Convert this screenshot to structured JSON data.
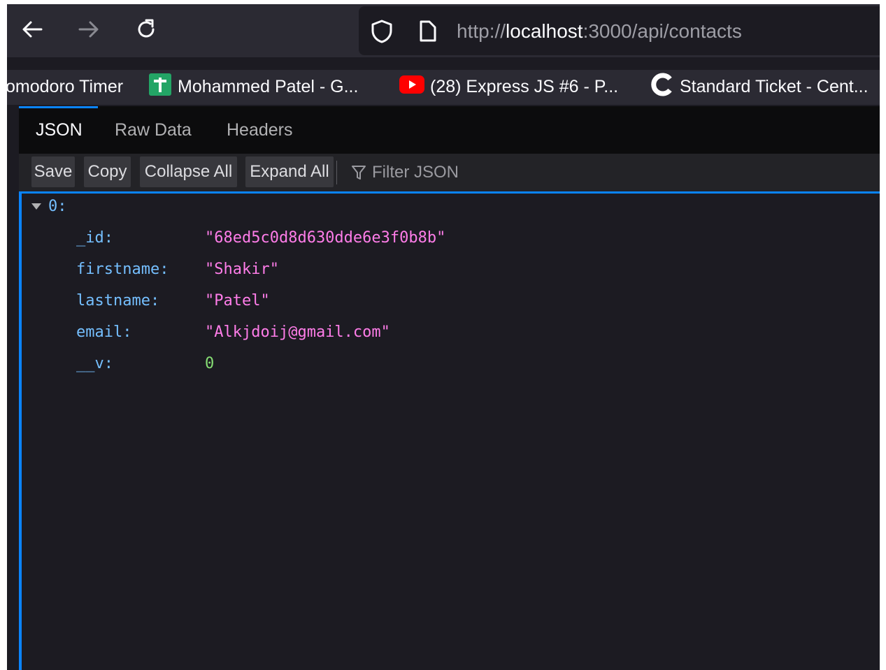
{
  "toolbar": {
    "back_icon": "arrow-left-icon",
    "forward_icon": "arrow-right-icon",
    "reload_icon": "reload-icon",
    "shield_icon": "shield-icon",
    "page_icon": "page-icon",
    "url_prefix": "http://",
    "url_host": "localhost",
    "url_rest": ":3000/api/contacts"
  },
  "bookmarks": [
    {
      "label": "omodoro Timer"
    },
    {
      "label": "Mohammed Patel - G...",
      "icon": "green-plus-icon"
    },
    {
      "label": "(28) Express JS #6 - P...",
      "icon": "youtube-icon"
    },
    {
      "label": "Standard Ticket - Cent...",
      "icon": "c-logo-icon"
    }
  ],
  "tabs": [
    {
      "label": "JSON",
      "active": true
    },
    {
      "label": "Raw Data"
    },
    {
      "label": "Headers"
    }
  ],
  "buttons": {
    "save": "Save",
    "copy": "Copy",
    "collapse": "Collapse All",
    "expand": "Expand All",
    "filter_placeholder": "Filter JSON"
  },
  "json": {
    "root_key": "0:",
    "rows": [
      {
        "key": "_id:",
        "value": "\"68ed5c0d8d630dde6e3f0b8b\"",
        "kind": "string"
      },
      {
        "key": "firstname:",
        "value": "\"Shakir\"",
        "kind": "string"
      },
      {
        "key": "lastname:",
        "value": "\"Patel\"",
        "kind": "string"
      },
      {
        "key": "email:",
        "value": "\"Alkjdoij@gmail.com\"",
        "kind": "string"
      },
      {
        "key": "__v:",
        "value": "0",
        "kind": "number"
      }
    ]
  },
  "colors": {
    "accent": "#0a84ff",
    "key": "#75bfff",
    "string": "#ff7de9",
    "number": "#86de74"
  }
}
